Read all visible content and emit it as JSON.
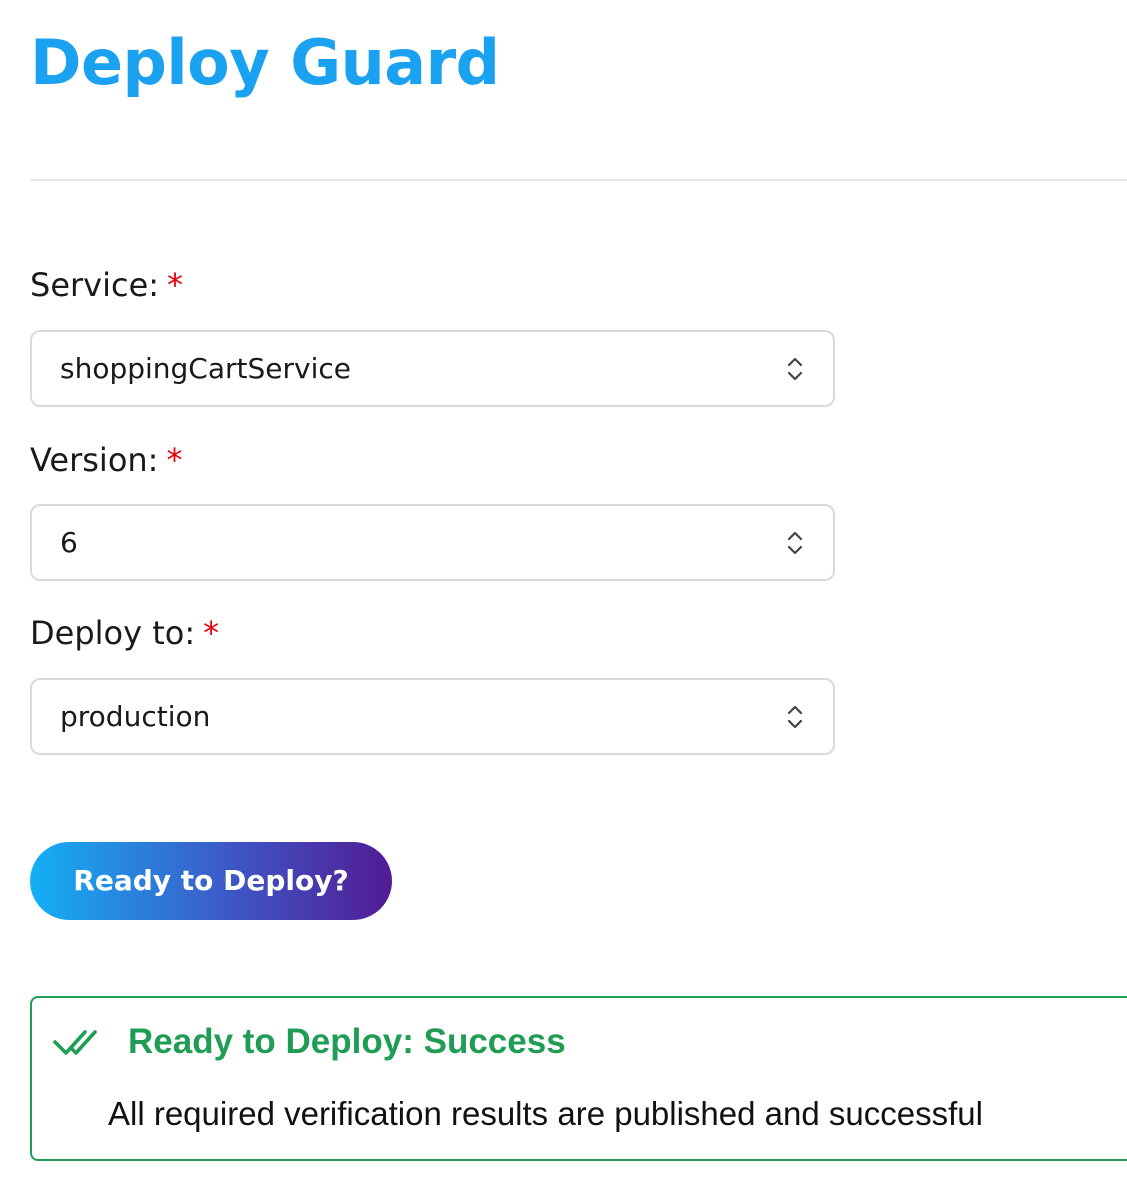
{
  "app": {
    "title": "Deploy Guard"
  },
  "form": {
    "required_marker": "*",
    "service": {
      "label": "Service:",
      "value": "shoppingCartService"
    },
    "version": {
      "label": "Version:",
      "value": "6"
    },
    "environment": {
      "label": "Deploy to:",
      "value": "production"
    },
    "submit_label": "Ready to Deploy?"
  },
  "result": {
    "title": "Ready to Deploy: Success",
    "message": "All required verification results are published and successful",
    "icon": "double-check-icon",
    "color": "#1f9d55"
  },
  "colors": {
    "title": "#1aa1ef",
    "required": "#e8000b",
    "button_gradient_start": "#13b0f5",
    "button_gradient_end": "#521b94",
    "success": "#1f9d55"
  }
}
